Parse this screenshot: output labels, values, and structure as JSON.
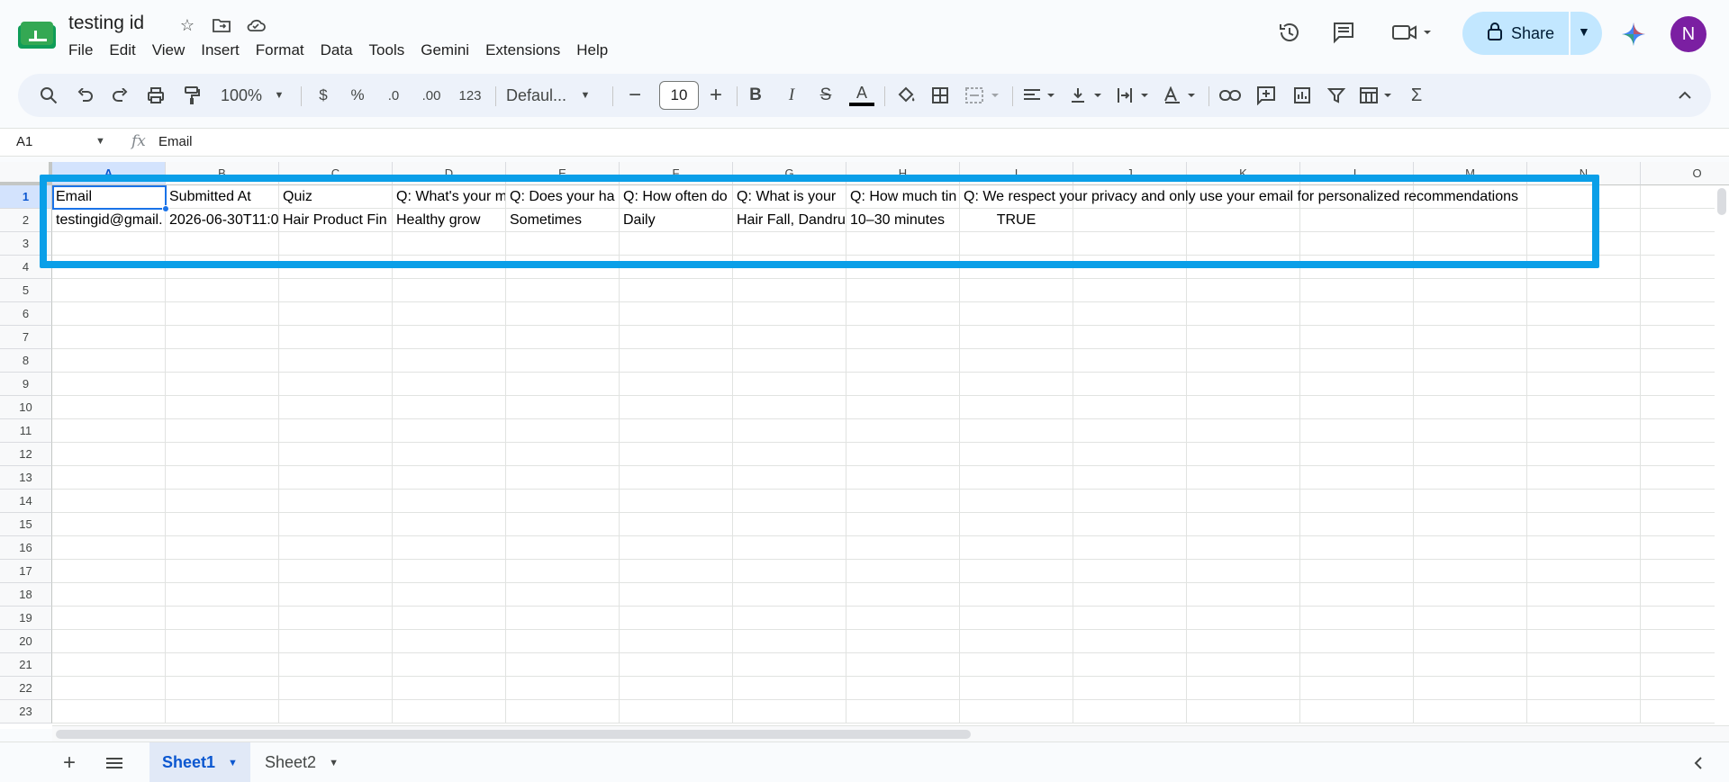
{
  "doc": {
    "title": "testing id"
  },
  "menu": [
    "File",
    "Edit",
    "View",
    "Insert",
    "Format",
    "Data",
    "Tools",
    "Gemini",
    "Extensions",
    "Help"
  ],
  "share": {
    "label": "Share"
  },
  "user": {
    "initial": "N",
    "color": "#7b1fa2"
  },
  "toolbar": {
    "zoom": "100%",
    "currency": "$",
    "percent": "%",
    "dec_less": ".0",
    "dec_more": ".00",
    "format_123": "123",
    "font": "Defaul...",
    "font_size": "10"
  },
  "formula_bar": {
    "cell_ref": "A1",
    "fx": "fx",
    "content": "Email"
  },
  "columns": [
    "A",
    "B",
    "C",
    "D",
    "E",
    "F",
    "G",
    "H",
    "I",
    "J",
    "K",
    "L",
    "M",
    "N",
    "O"
  ],
  "rows": [
    "1",
    "2",
    "3",
    "4",
    "5",
    "6",
    "7",
    "8",
    "9",
    "10",
    "11",
    "12",
    "13",
    "14",
    "15",
    "16",
    "17",
    "18",
    "19",
    "20",
    "21",
    "22",
    "23"
  ],
  "cells": {
    "r1": [
      "Email",
      "Submitted At",
      "Quiz",
      "Q: What's your m",
      "Q: Does your ha",
      "Q: How often do",
      "Q: What is your",
      "Q: How much tin",
      "Q: We respect your privacy and only use your email for personalized recommendations"
    ],
    "r2": [
      "testingid@gmail.",
      "2026-06-30T11:0",
      "Hair Product Fin",
      "Healthy grow",
      "Sometimes",
      "Daily",
      "Hair Fall, Dandru",
      "10–30 minutes",
      "TRUE"
    ]
  },
  "sheets": [
    {
      "name": "Sheet1",
      "active": true
    },
    {
      "name": "Sheet2",
      "active": false
    }
  ],
  "colors": {
    "accent": "#0b57d0",
    "highlight_box": "#0a9fe8",
    "share_bg": "#c2e7ff"
  }
}
